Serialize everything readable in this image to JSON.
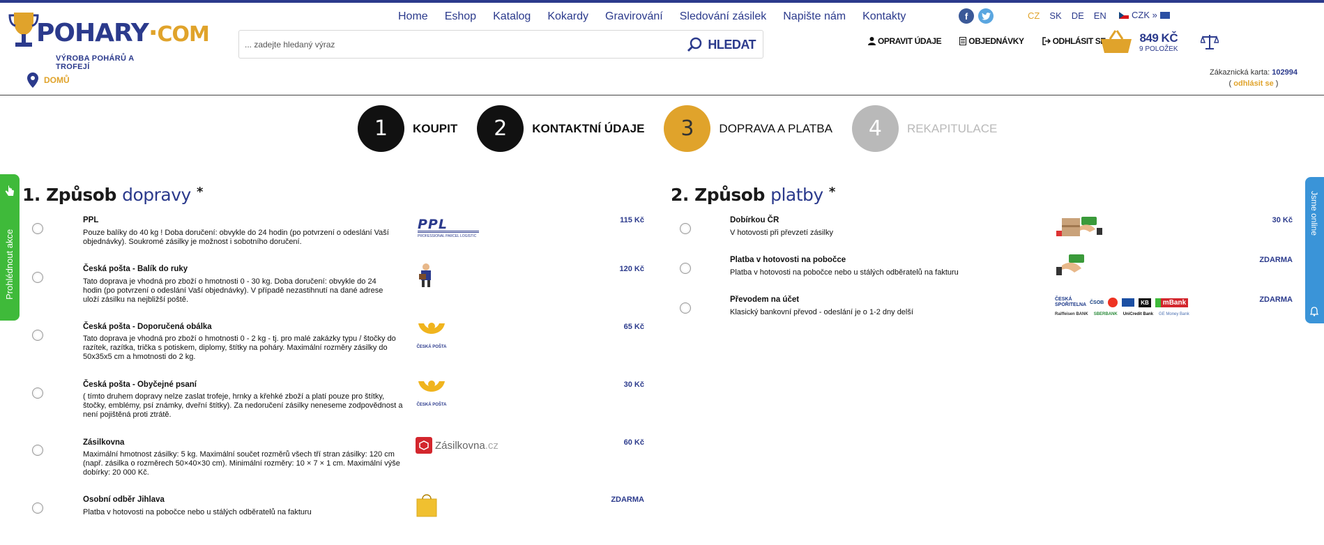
{
  "logo": {
    "brand": "POHARY",
    "dot": "·",
    "tld": "COM",
    "subtitle": "VÝROBA POHÁRŮ A TROFEJÍ"
  },
  "nav": [
    "Home",
    "Eshop",
    "Katalog",
    "Kokardy",
    "Gravirování",
    "Sledování zásilek",
    "Napište nám",
    "Kontakty"
  ],
  "langs": [
    "CZ",
    "SK",
    "DE",
    "EN"
  ],
  "currency": "CZK »",
  "search": {
    "placeholder": "... zadejte hledaný výraz",
    "button": "HLEDAT"
  },
  "user_nav": {
    "edit": "OPRAVIT ÚDAJE",
    "orders": "OBJEDNÁVKY",
    "logout": "ODHLÁSIT SE"
  },
  "cart": {
    "price": "849 KČ",
    "items": "9 POLOŽEK"
  },
  "breadcrumb": "DOMŮ",
  "customer": {
    "label": "Zákaznická karta:",
    "number": "102994",
    "open": "(",
    "logout": "odhlásit se",
    "close": ")"
  },
  "steps": [
    {
      "num": "1",
      "label": "KOUPIT"
    },
    {
      "num": "2",
      "label": "KONTAKTNÍ ÚDAJE"
    },
    {
      "num": "3",
      "label": "DOPRAVA A PLATBA"
    },
    {
      "num": "4",
      "label": "REKAPITULACE"
    }
  ],
  "shipping": {
    "title_prefix": "1. Způsob",
    "title_highlight": "dopravy",
    "star": "*",
    "options": [
      {
        "name": "PPL",
        "desc": "Pouze balíky do 40 kg ! Doba doručení: obvykle do 24 hodin (po potvrzení o odeslání Vaší objednávky). Soukromé zásilky je možnost i sobotního doručení.",
        "price": "115 Kč",
        "logo": "ppl-logo"
      },
      {
        "name": "Česká pošta - Balík do ruky",
        "desc": "Tato doprava je vhodná pro zboží o hmotnosti 0 - 30 kg. Doba doručení: obvykle do 24 hodin (po potvrzení o odeslání Vaší objednávky). V případě nezastihnutí na dané adrese uloží zásilku na nejbližší poště.",
        "price": "120 Kč",
        "logo": "postman-icon"
      },
      {
        "name": "Česká pošta - Doporučená obálka",
        "desc": "Tato doprava je vhodná pro zboží o hmotnosti 0 - 2 kg - tj. pro malé zakázky typu / štočky do razítek, razítka, trička s potiskem, diplomy, štítky na poháry. Maximální rozměry zásilky do 50x35x5 cm a hmotnosti do 2 kg.",
        "price": "65 Kč",
        "logo": "ceska-posta-logo"
      },
      {
        "name": "Česká pošta - Obyčejné psaní",
        "desc": "( tímto druhem dopravy nelze zaslat trofeje, hrnky a křehké zboží a platí pouze pro štítky, štočky, emblémy, psí známky, dveřní štítky). Za nedoručení zásilky neneseme zodpovědnost a není pojištěná proti ztrátě.",
        "price": "30 Kč",
        "logo": "ceska-posta-logo"
      },
      {
        "name": "Zásilkovna",
        "desc": "Maximální hmotnost zásilky: 5 kg. Maximální součet rozměrů všech tří stran zásilky: 120 cm (např. zásilka o rozměrech 50×40×30 cm). Minimální rozměry: 10 × 7 × 1 cm. Maximální výše dobírky: 20 000 Kč.",
        "price": "60 Kč",
        "logo": "zasilkovna-logo"
      },
      {
        "name": "Osobní odběr Jihlava",
        "desc": "Platba v hotovosti na pobočce nebo u stálých odběratelů na fakturu",
        "price": "ZDARMA",
        "logo": "shopping-bag-icon"
      }
    ],
    "posta_text": "ČESKÁ POŠTA",
    "ppl_sub": "PROFESSIONAL PARCEL LOGISTIC",
    "ppl_text": "PPL",
    "zasilkovna_text": "Zásilkovna",
    "zasilkovna_tld": ".cz"
  },
  "payment": {
    "title_prefix": "2. Způsob",
    "title_highlight": "platby",
    "star": "*",
    "options": [
      {
        "name": "Dobírkou ČR",
        "desc": "V hotovosti při převzetí zásilky",
        "price": "30 Kč"
      },
      {
        "name": "Platba v hotovosti na pobočce",
        "desc": "Platba v hotovosti na pobočce nebo u stálých odběratelů na fakturu",
        "price": "ZDARMA"
      },
      {
        "name": "Převodem na účet",
        "desc": "Klasický bankovní převod - odeslání je o 1-2 dny delší",
        "price": "ZDARMA"
      }
    ],
    "banks_row1": [
      "ČESKÁ SPOŘITELNA",
      "ČSOB",
      "KB",
      "mBank"
    ],
    "banks_row2": [
      "Raiffeisen BANK",
      "SBERBANK",
      "UniCredit Bank",
      "GE Money Bank"
    ]
  },
  "side_left": "Prohlédnout akce",
  "side_right": "Jsme online",
  "colors": {
    "brand": "#2b3a8c",
    "accent": "#e0a32b",
    "green": "#3fba3a",
    "blue": "#3a94d8"
  }
}
